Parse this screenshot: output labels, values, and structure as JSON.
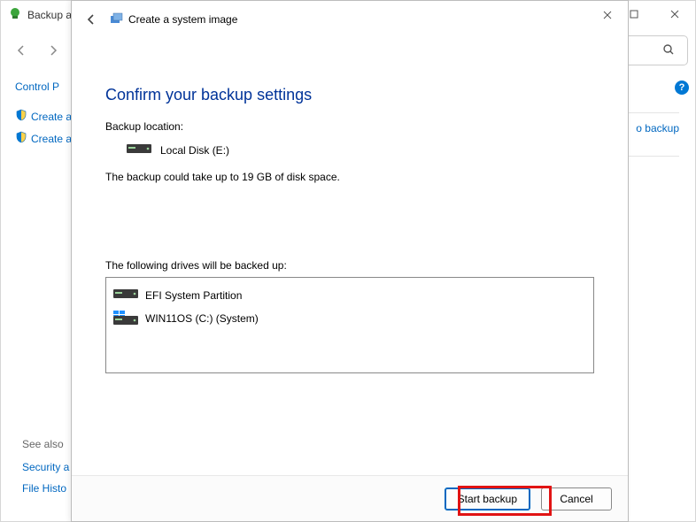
{
  "back_window": {
    "title": "Backup a",
    "nav_back_label": "Back",
    "nav_fwd_label": "Forward",
    "search_placeholder": "Search",
    "cp_home": "Control P",
    "sidebar": [
      {
        "label": "Create a s"
      },
      {
        "label": "Create a s"
      }
    ],
    "right_link": "o backup",
    "see_also_heading": "See also",
    "see_also_links": [
      "Security a",
      "File Histo"
    ]
  },
  "wizard": {
    "title": "Create a system image",
    "heading": "Confirm your backup settings",
    "location_label": "Backup location:",
    "location_value": "Local Disk (E:)",
    "estimate": "The backup could take up to 19 GB of disk space.",
    "drives_label": "The following drives will be backed up:",
    "drives": [
      {
        "name": "EFI System Partition",
        "icon": "drive"
      },
      {
        "name": "WIN11OS (C:) (System)",
        "icon": "windrive"
      }
    ],
    "buttons": {
      "start": "Start backup",
      "cancel": "Cancel"
    }
  }
}
